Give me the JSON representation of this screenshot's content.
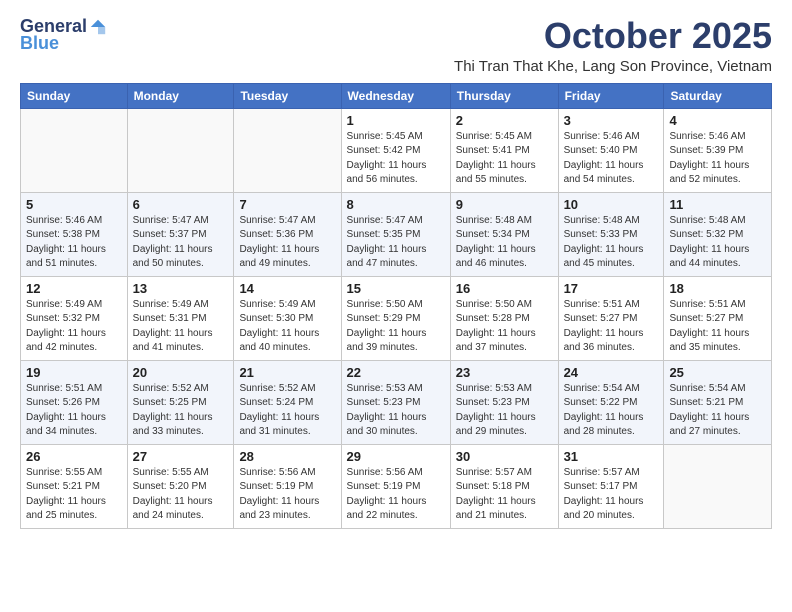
{
  "logo": {
    "general": "General",
    "blue": "Blue"
  },
  "header": {
    "month": "October 2025",
    "location": "Thi Tran That Khe, Lang Son Province, Vietnam"
  },
  "weekdays": [
    "Sunday",
    "Monday",
    "Tuesday",
    "Wednesday",
    "Thursday",
    "Friday",
    "Saturday"
  ],
  "weeks": [
    [
      {
        "day": "",
        "info": ""
      },
      {
        "day": "",
        "info": ""
      },
      {
        "day": "",
        "info": ""
      },
      {
        "day": "1",
        "info": "Sunrise: 5:45 AM\nSunset: 5:42 PM\nDaylight: 11 hours\nand 56 minutes."
      },
      {
        "day": "2",
        "info": "Sunrise: 5:45 AM\nSunset: 5:41 PM\nDaylight: 11 hours\nand 55 minutes."
      },
      {
        "day": "3",
        "info": "Sunrise: 5:46 AM\nSunset: 5:40 PM\nDaylight: 11 hours\nand 54 minutes."
      },
      {
        "day": "4",
        "info": "Sunrise: 5:46 AM\nSunset: 5:39 PM\nDaylight: 11 hours\nand 52 minutes."
      }
    ],
    [
      {
        "day": "5",
        "info": "Sunrise: 5:46 AM\nSunset: 5:38 PM\nDaylight: 11 hours\nand 51 minutes."
      },
      {
        "day": "6",
        "info": "Sunrise: 5:47 AM\nSunset: 5:37 PM\nDaylight: 11 hours\nand 50 minutes."
      },
      {
        "day": "7",
        "info": "Sunrise: 5:47 AM\nSunset: 5:36 PM\nDaylight: 11 hours\nand 49 minutes."
      },
      {
        "day": "8",
        "info": "Sunrise: 5:47 AM\nSunset: 5:35 PM\nDaylight: 11 hours\nand 47 minutes."
      },
      {
        "day": "9",
        "info": "Sunrise: 5:48 AM\nSunset: 5:34 PM\nDaylight: 11 hours\nand 46 minutes."
      },
      {
        "day": "10",
        "info": "Sunrise: 5:48 AM\nSunset: 5:33 PM\nDaylight: 11 hours\nand 45 minutes."
      },
      {
        "day": "11",
        "info": "Sunrise: 5:48 AM\nSunset: 5:32 PM\nDaylight: 11 hours\nand 44 minutes."
      }
    ],
    [
      {
        "day": "12",
        "info": "Sunrise: 5:49 AM\nSunset: 5:32 PM\nDaylight: 11 hours\nand 42 minutes."
      },
      {
        "day": "13",
        "info": "Sunrise: 5:49 AM\nSunset: 5:31 PM\nDaylight: 11 hours\nand 41 minutes."
      },
      {
        "day": "14",
        "info": "Sunrise: 5:49 AM\nSunset: 5:30 PM\nDaylight: 11 hours\nand 40 minutes."
      },
      {
        "day": "15",
        "info": "Sunrise: 5:50 AM\nSunset: 5:29 PM\nDaylight: 11 hours\nand 39 minutes."
      },
      {
        "day": "16",
        "info": "Sunrise: 5:50 AM\nSunset: 5:28 PM\nDaylight: 11 hours\nand 37 minutes."
      },
      {
        "day": "17",
        "info": "Sunrise: 5:51 AM\nSunset: 5:27 PM\nDaylight: 11 hours\nand 36 minutes."
      },
      {
        "day": "18",
        "info": "Sunrise: 5:51 AM\nSunset: 5:27 PM\nDaylight: 11 hours\nand 35 minutes."
      }
    ],
    [
      {
        "day": "19",
        "info": "Sunrise: 5:51 AM\nSunset: 5:26 PM\nDaylight: 11 hours\nand 34 minutes."
      },
      {
        "day": "20",
        "info": "Sunrise: 5:52 AM\nSunset: 5:25 PM\nDaylight: 11 hours\nand 33 minutes."
      },
      {
        "day": "21",
        "info": "Sunrise: 5:52 AM\nSunset: 5:24 PM\nDaylight: 11 hours\nand 31 minutes."
      },
      {
        "day": "22",
        "info": "Sunrise: 5:53 AM\nSunset: 5:23 PM\nDaylight: 11 hours\nand 30 minutes."
      },
      {
        "day": "23",
        "info": "Sunrise: 5:53 AM\nSunset: 5:23 PM\nDaylight: 11 hours\nand 29 minutes."
      },
      {
        "day": "24",
        "info": "Sunrise: 5:54 AM\nSunset: 5:22 PM\nDaylight: 11 hours\nand 28 minutes."
      },
      {
        "day": "25",
        "info": "Sunrise: 5:54 AM\nSunset: 5:21 PM\nDaylight: 11 hours\nand 27 minutes."
      }
    ],
    [
      {
        "day": "26",
        "info": "Sunrise: 5:55 AM\nSunset: 5:21 PM\nDaylight: 11 hours\nand 25 minutes."
      },
      {
        "day": "27",
        "info": "Sunrise: 5:55 AM\nSunset: 5:20 PM\nDaylight: 11 hours\nand 24 minutes."
      },
      {
        "day": "28",
        "info": "Sunrise: 5:56 AM\nSunset: 5:19 PM\nDaylight: 11 hours\nand 23 minutes."
      },
      {
        "day": "29",
        "info": "Sunrise: 5:56 AM\nSunset: 5:19 PM\nDaylight: 11 hours\nand 22 minutes."
      },
      {
        "day": "30",
        "info": "Sunrise: 5:57 AM\nSunset: 5:18 PM\nDaylight: 11 hours\nand 21 minutes."
      },
      {
        "day": "31",
        "info": "Sunrise: 5:57 AM\nSunset: 5:17 PM\nDaylight: 11 hours\nand 20 minutes."
      },
      {
        "day": "",
        "info": ""
      }
    ]
  ]
}
